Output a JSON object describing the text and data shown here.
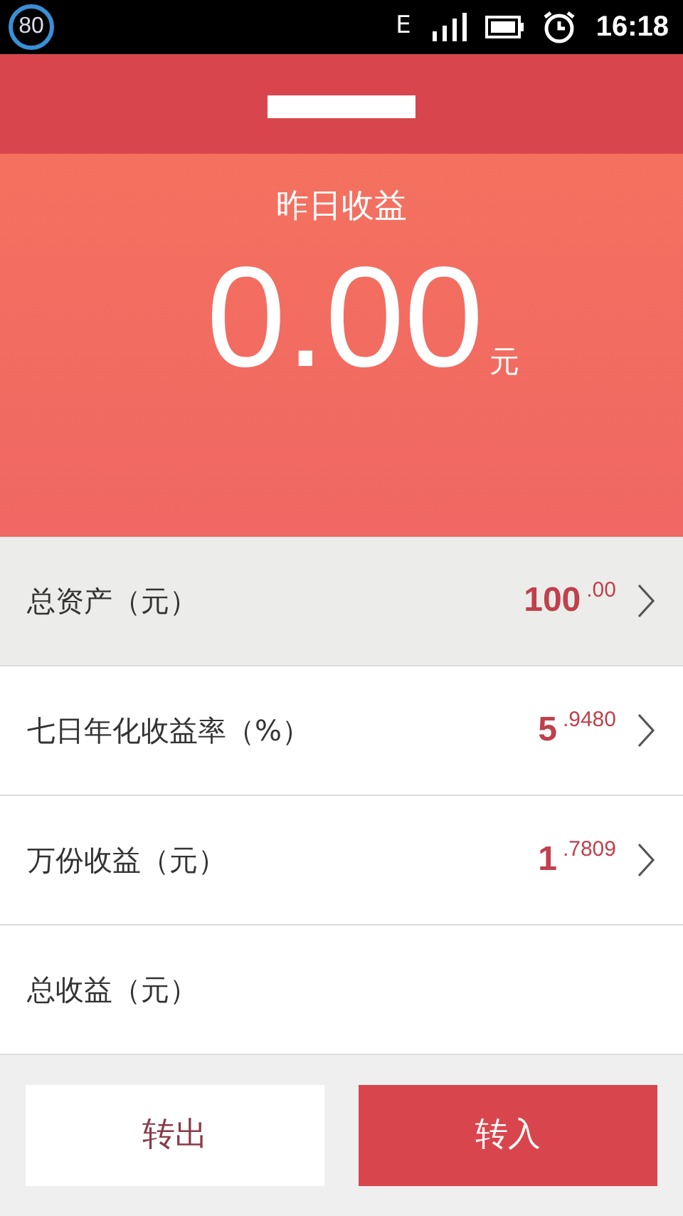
{
  "status_bar": {
    "badge": "80",
    "network": "E",
    "time": "16:18"
  },
  "header": {
    "title_redacted": true
  },
  "hero": {
    "label": "昨日收益",
    "amount": "0.00",
    "unit": "元"
  },
  "rows": [
    {
      "label": "总资产（元）",
      "value": "100",
      "fraction": ".00",
      "kind": "link",
      "selected": true
    },
    {
      "label": "七日年化收益率（%）",
      "value": "5",
      "fraction": ".9480",
      "kind": "link",
      "selected": false
    },
    {
      "label": "万份收益（元）",
      "value": "1",
      "fraction": ".7809",
      "kind": "link",
      "selected": false
    },
    {
      "label": "总收益（元）",
      "kind": "plain",
      "selected": false
    }
  ],
  "buttons": [
    {
      "label": "转出",
      "kind": "secondary"
    },
    {
      "label": "转入",
      "kind": "primary"
    }
  ]
}
